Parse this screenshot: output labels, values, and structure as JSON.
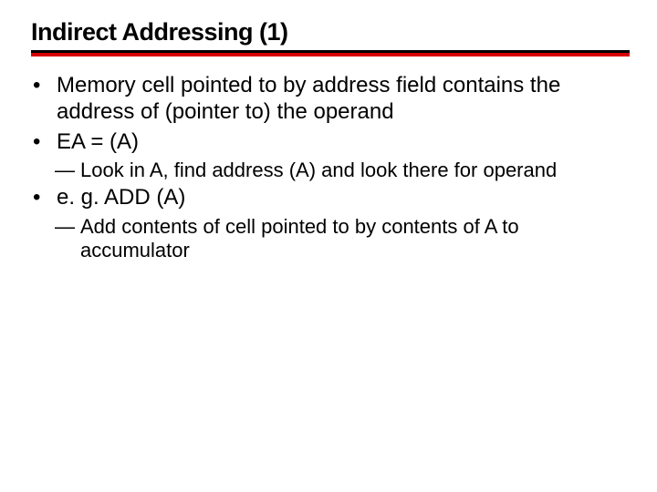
{
  "title": "Indirect Addressing (1)",
  "bullets": {
    "b1": "Memory cell pointed to by address field contains the address of (pointer to) the operand",
    "b2": "EA = (A)",
    "b2a": "Look in A, find address (A) and look there for operand",
    "b3": "e. g. ADD (A)",
    "b3a": "Add contents of cell pointed to by contents of A to accumulator"
  },
  "glyphs": {
    "dot": "•",
    "dash": "—"
  }
}
